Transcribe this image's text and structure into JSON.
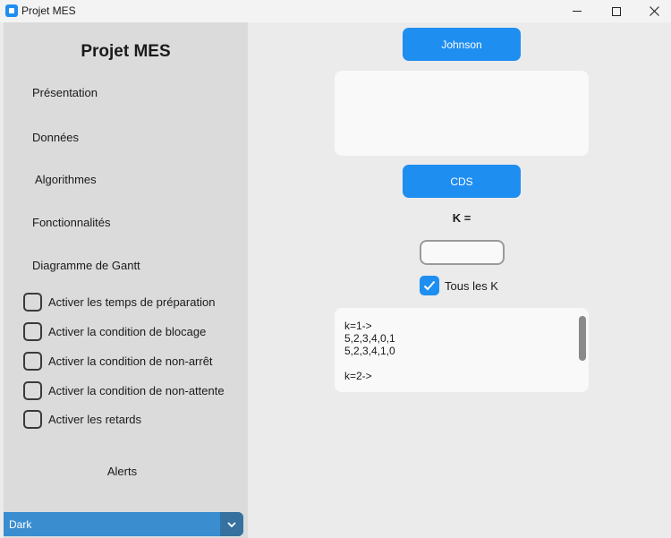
{
  "window": {
    "title": "Projet MES"
  },
  "sidebar": {
    "title": "Projet MES",
    "nav": [
      {
        "label": "Présentation"
      },
      {
        "label": "Données"
      },
      {
        "label": "Algorithmes"
      },
      {
        "label": "Fonctionnalités"
      },
      {
        "label": "Diagramme de Gantt"
      }
    ],
    "options": [
      {
        "label": "Activer les temps de préparation",
        "checked": false
      },
      {
        "label": "Activer la condition de blocage",
        "checked": false
      },
      {
        "label": "Activer la condition de non-arrêt",
        "checked": false
      },
      {
        "label": "Activer la condition de non-attente",
        "checked": false
      },
      {
        "label": "Activer les retards",
        "checked": false
      }
    ],
    "alerts_label": "Alerts",
    "theme_select": {
      "value": "Dark"
    }
  },
  "main": {
    "johnson_button": "Johnson",
    "johnson_output": "",
    "cds_button": "CDS",
    "k_label": "K =",
    "k_input_value": "",
    "all_k": {
      "label": "Tous les K",
      "checked": true
    },
    "results_text": "k=1->\n5,2,3,4,0,1\n5,2,3,4,1,0\n\nk=2->"
  },
  "colors": {
    "accent": "#1f8ef1",
    "sidebar_bg": "#dbdbdb",
    "main_bg": "#ebebeb",
    "panel_bg": "#f9f9f9",
    "dropdown_bg": "#3a8ed0"
  }
}
